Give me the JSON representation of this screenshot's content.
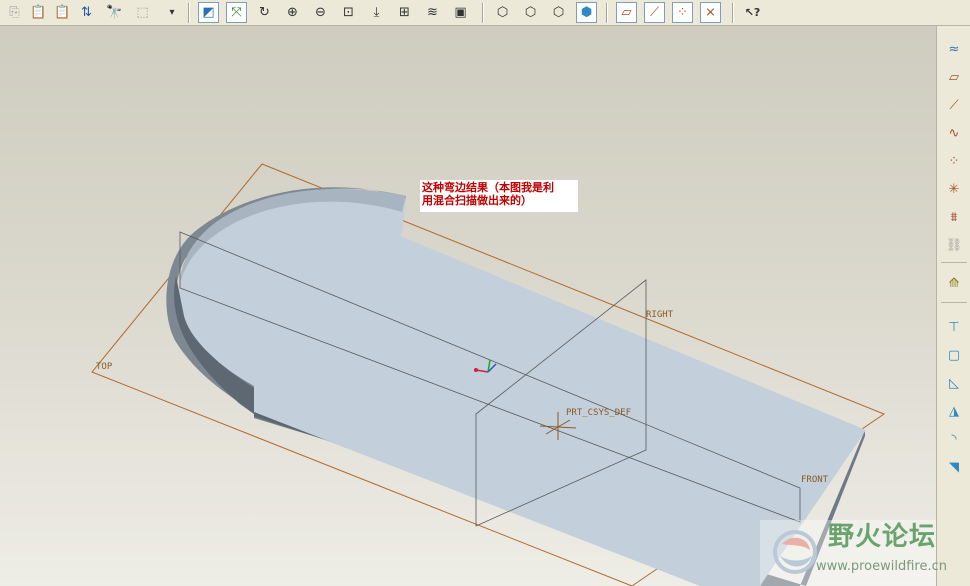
{
  "toolbar": {
    "buttons": [
      {
        "name": "copy-icon",
        "glyph": "⎘",
        "state": "disabled"
      },
      {
        "name": "paste-icon",
        "glyph": "📋",
        "state": "disabled"
      },
      {
        "name": "paste-special-icon",
        "glyph": "📋",
        "state": "disabled"
      },
      {
        "name": "regenerate-icon",
        "glyph": "⇅",
        "state": "normal"
      },
      {
        "name": "find-icon",
        "glyph": "🔭",
        "state": "normal"
      },
      {
        "name": "select-box-icon",
        "glyph": "⬚",
        "state": "disabled"
      },
      {
        "name": "dropdown-icon",
        "glyph": "▾",
        "state": "normal"
      },
      {
        "name": "sketch-view-icon",
        "glyph": "◩",
        "state": "pressed"
      },
      {
        "name": "spin-center-icon",
        "glyph": "⤧",
        "state": "pressed"
      },
      {
        "name": "orient-mode-icon",
        "glyph": "↻",
        "state": "normal"
      },
      {
        "name": "zoom-in-icon",
        "glyph": "⊕",
        "state": "normal"
      },
      {
        "name": "zoom-out-icon",
        "glyph": "⊖",
        "state": "normal"
      },
      {
        "name": "refit-icon",
        "glyph": "⊡",
        "state": "normal"
      },
      {
        "name": "reorient-icon",
        "glyph": "⤓",
        "state": "normal"
      },
      {
        "name": "saved-views-icon",
        "glyph": "⊞",
        "state": "normal"
      },
      {
        "name": "layers-icon",
        "glyph": "≋",
        "state": "normal"
      },
      {
        "name": "view-manager-icon",
        "glyph": "▣",
        "state": "normal"
      },
      {
        "name": "wireframe-icon",
        "glyph": "⬡",
        "state": "normal"
      },
      {
        "name": "hidden-line-icon",
        "glyph": "⬡",
        "state": "normal"
      },
      {
        "name": "no-hidden-icon",
        "glyph": "⬡",
        "state": "normal"
      },
      {
        "name": "shading-icon",
        "glyph": "⬢",
        "state": "pressed"
      },
      {
        "name": "datum-plane-display-icon",
        "glyph": "▱",
        "state": "pressed"
      },
      {
        "name": "datum-axis-display-icon",
        "glyph": "⟋",
        "state": "pressed"
      },
      {
        "name": "datum-point-display-icon",
        "glyph": "⁘",
        "state": "pressed"
      },
      {
        "name": "csys-display-icon",
        "glyph": "⨯",
        "state": "pressed"
      },
      {
        "name": "context-help-icon",
        "glyph": "↖?",
        "state": "normal"
      }
    ]
  },
  "right_toolbar": {
    "buttons": [
      {
        "name": "sketch-tool-icon",
        "glyph": "≈",
        "state": "normal"
      },
      {
        "name": "datum-plane-tool-icon",
        "glyph": "▱",
        "state": "normal"
      },
      {
        "name": "datum-axis-tool-icon",
        "glyph": "⟋",
        "state": "normal"
      },
      {
        "name": "datum-curve-tool-icon",
        "glyph": "∿",
        "state": "normal"
      },
      {
        "name": "datum-point-tool-icon",
        "glyph": "⁘",
        "state": "normal"
      },
      {
        "name": "coordinate-system-tool-icon",
        "glyph": "✳",
        "state": "normal"
      },
      {
        "name": "analysis-feature-icon",
        "glyph": "⩩",
        "state": "normal"
      },
      {
        "name": "chain-icon",
        "glyph": "⛓",
        "state": "disabled"
      },
      {
        "name": "note-icon",
        "glyph": "⟰",
        "state": "normal"
      },
      {
        "name": "extrude-icon",
        "glyph": "⊤",
        "state": "normal"
      },
      {
        "name": "shell-icon",
        "glyph": "▢",
        "state": "normal"
      },
      {
        "name": "draft-icon",
        "glyph": "◺",
        "state": "normal"
      },
      {
        "name": "rib-icon",
        "glyph": "◮",
        "state": "normal"
      },
      {
        "name": "round-icon",
        "glyph": "◝",
        "state": "normal"
      },
      {
        "name": "chamfer-icon",
        "glyph": "◥",
        "state": "normal"
      }
    ]
  },
  "viewport": {
    "note_lines": [
      "这种弯边结果（本图我是利",
      "用混合扫描做出来的）"
    ],
    "datums": {
      "top": "TOP",
      "right": "RIGHT",
      "front": "FRONT",
      "csys": "PRT_CSYS_DEF"
    }
  },
  "watermark": {
    "title": "野火论坛",
    "url": "www.proewildfire.cn"
  },
  "colors": {
    "part": "#c3cfdb",
    "part_side": "#6f7a85",
    "datum": "#b06a2c",
    "accent_pressed": "#7d9ec0"
  }
}
